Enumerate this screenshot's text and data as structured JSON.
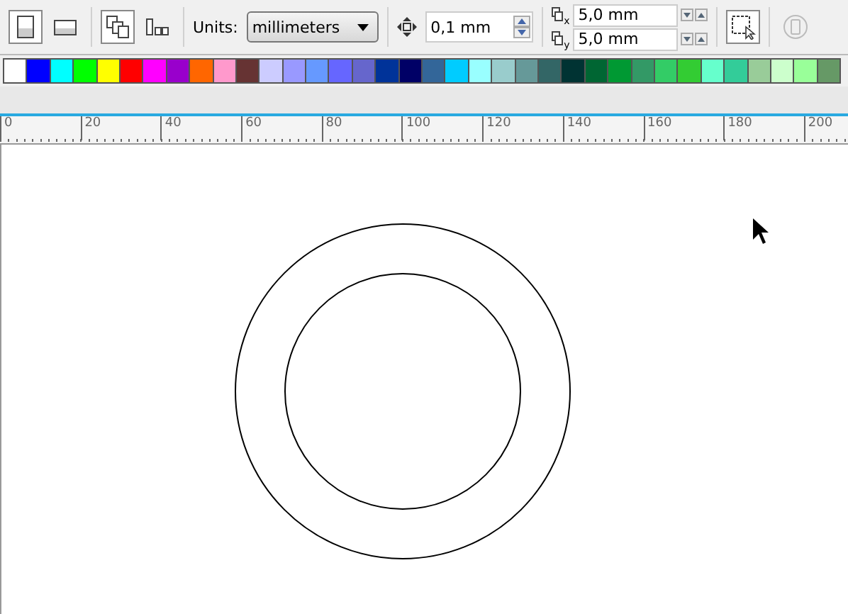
{
  "toolbar": {
    "orientation": [
      {
        "kind": "portrait",
        "selected": true
      },
      {
        "kind": "landscape",
        "selected": false
      }
    ],
    "page_layout": [
      {
        "kind": "all-pages",
        "selected": true
      },
      {
        "kind": "current-page",
        "selected": false
      }
    ],
    "units": {
      "label": "Units:",
      "value": "millimeters"
    },
    "nudge": {
      "value": "0,1 mm"
    },
    "duplicate": [
      {
        "axis": "x",
        "value": "5,0 mm"
      },
      {
        "axis": "y",
        "value": "5,0 mm"
      }
    ],
    "treat_as_filled": {
      "selected": true
    },
    "last_tool": {
      "disabled": true
    }
  },
  "palette": [
    {
      "color": "#ffffff"
    },
    {
      "color": "#0000ff"
    },
    {
      "color": "#00ffff"
    },
    {
      "color": "#00ff00"
    },
    {
      "color": "#ffff00"
    },
    {
      "color": "#ff0000"
    },
    {
      "color": "#ff00ff"
    },
    {
      "color": "#9900cc"
    },
    {
      "color": "#ff6600"
    },
    {
      "color": "#ff99cc"
    },
    {
      "color": "#663333"
    },
    {
      "color": "#ccccff"
    },
    {
      "color": "#9999ff"
    },
    {
      "color": "#6699ff"
    },
    {
      "color": "#6666ff"
    },
    {
      "color": "#6666cc"
    },
    {
      "color": "#003399"
    },
    {
      "color": "#000066"
    },
    {
      "color": "#336699"
    },
    {
      "color": "#00ccff"
    },
    {
      "color": "#99ffff"
    },
    {
      "color": "#99cccc"
    },
    {
      "color": "#669999"
    },
    {
      "color": "#336666"
    },
    {
      "color": "#003333"
    },
    {
      "color": "#006633"
    },
    {
      "color": "#009933"
    },
    {
      "color": "#339966"
    },
    {
      "color": "#33cc66"
    },
    {
      "color": "#33cc33"
    },
    {
      "color": "#66ffcc"
    },
    {
      "color": "#33cc99"
    },
    {
      "color": "#99cc99"
    },
    {
      "color": "#ccffcc"
    },
    {
      "color": "#99ff99"
    },
    {
      "color": "#669966"
    }
  ],
  "ruler": {
    "labels": [
      "0",
      "20",
      "40",
      "60",
      "80",
      "100",
      "120",
      "140",
      "160",
      "180",
      "200"
    ]
  }
}
